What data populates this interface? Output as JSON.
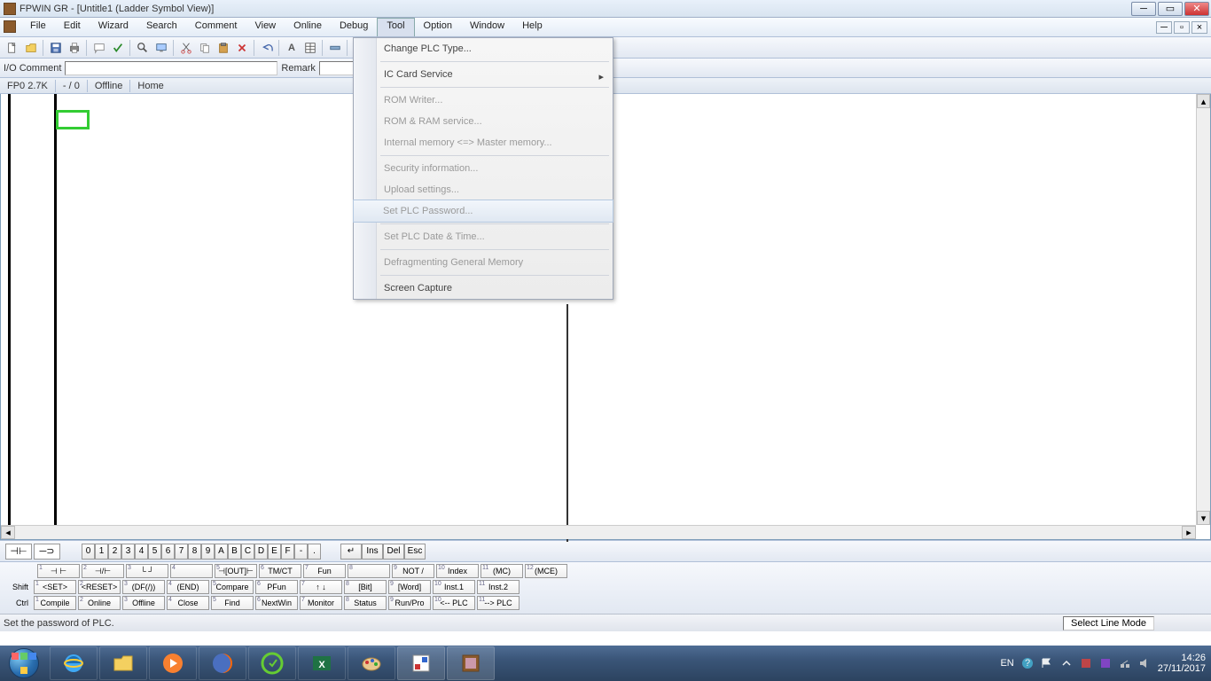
{
  "title": "FPWIN GR - [Untitle1 (Ladder Symbol View)]",
  "menus": [
    "File",
    "Edit",
    "Wizard",
    "Search",
    "Comment",
    "View",
    "Online",
    "Debug",
    "Tool",
    "Option",
    "Window",
    "Help"
  ],
  "active_menu_index": 8,
  "comment_bar": {
    "io_label": "I/O Comment",
    "remark_label": "Remark"
  },
  "status_row": {
    "plc": "FP0 2.7K",
    "steps": "- /      0",
    "mode": "Offline",
    "location": "Home"
  },
  "dropdown": {
    "items": [
      {
        "text": "Change PLC Type...",
        "disabled": false
      },
      {
        "divider": true
      },
      {
        "text": "IC Card Service",
        "disabled": false,
        "submenu": true
      },
      {
        "divider": true
      },
      {
        "text": "ROM Writer...",
        "disabled": true
      },
      {
        "text": "ROM & RAM service...",
        "disabled": true
      },
      {
        "text": "Internal memory <=> Master memory...",
        "disabled": true
      },
      {
        "divider": true
      },
      {
        "text": "Security information...",
        "disabled": true
      },
      {
        "text": "Upload settings...",
        "disabled": true
      },
      {
        "text": "Set PLC Password...",
        "disabled": true,
        "hover": true
      },
      {
        "divider": true
      },
      {
        "text": "Set PLC Date & Time...",
        "disabled": true
      },
      {
        "divider": true
      },
      {
        "text": "Defragmenting General Memory",
        "disabled": true
      },
      {
        "divider": true
      },
      {
        "text": "Screen Capture",
        "disabled": false
      }
    ]
  },
  "key_row": [
    "0",
    "1",
    "2",
    "3",
    "4",
    "5",
    "6",
    "7",
    "8",
    "9",
    "A",
    "B",
    "C",
    "D",
    "E",
    "F",
    "-",
    "."
  ],
  "key_row_extra": [
    "↵",
    "Ins",
    "Del",
    "Esc"
  ],
  "fn_rows": {
    "top": [
      "⊣ ⊢",
      "⊣/⊢",
      "└ ┘",
      "",
      "⊣[OUT]⊢",
      "TM/CT",
      "Fun",
      "",
      "NOT /",
      "Index",
      "(MC)",
      "(MCE)"
    ],
    "shift": [
      "<SET>",
      "<RESET>",
      "(DF(/))",
      "(END)",
      "Compare",
      "PFun",
      "↑  ↓",
      "[Bit]",
      "[Word]",
      "Inst.1",
      "Inst.2"
    ],
    "ctrl": [
      "Compile",
      "Online",
      "Offline",
      "Close",
      "Find",
      "NextWin",
      "Monitor",
      "Status",
      "Run/Pro",
      "<-- PLC",
      "--> PLC"
    ]
  },
  "fn_labels": {
    "shift": "Shift",
    "ctrl": "Ctrl"
  },
  "statusbar": {
    "msg": "Set the password of PLC.",
    "mode": "Select Line Mode"
  },
  "tray": {
    "lang": "EN",
    "time": "14:26",
    "date": "27/11/2017"
  }
}
